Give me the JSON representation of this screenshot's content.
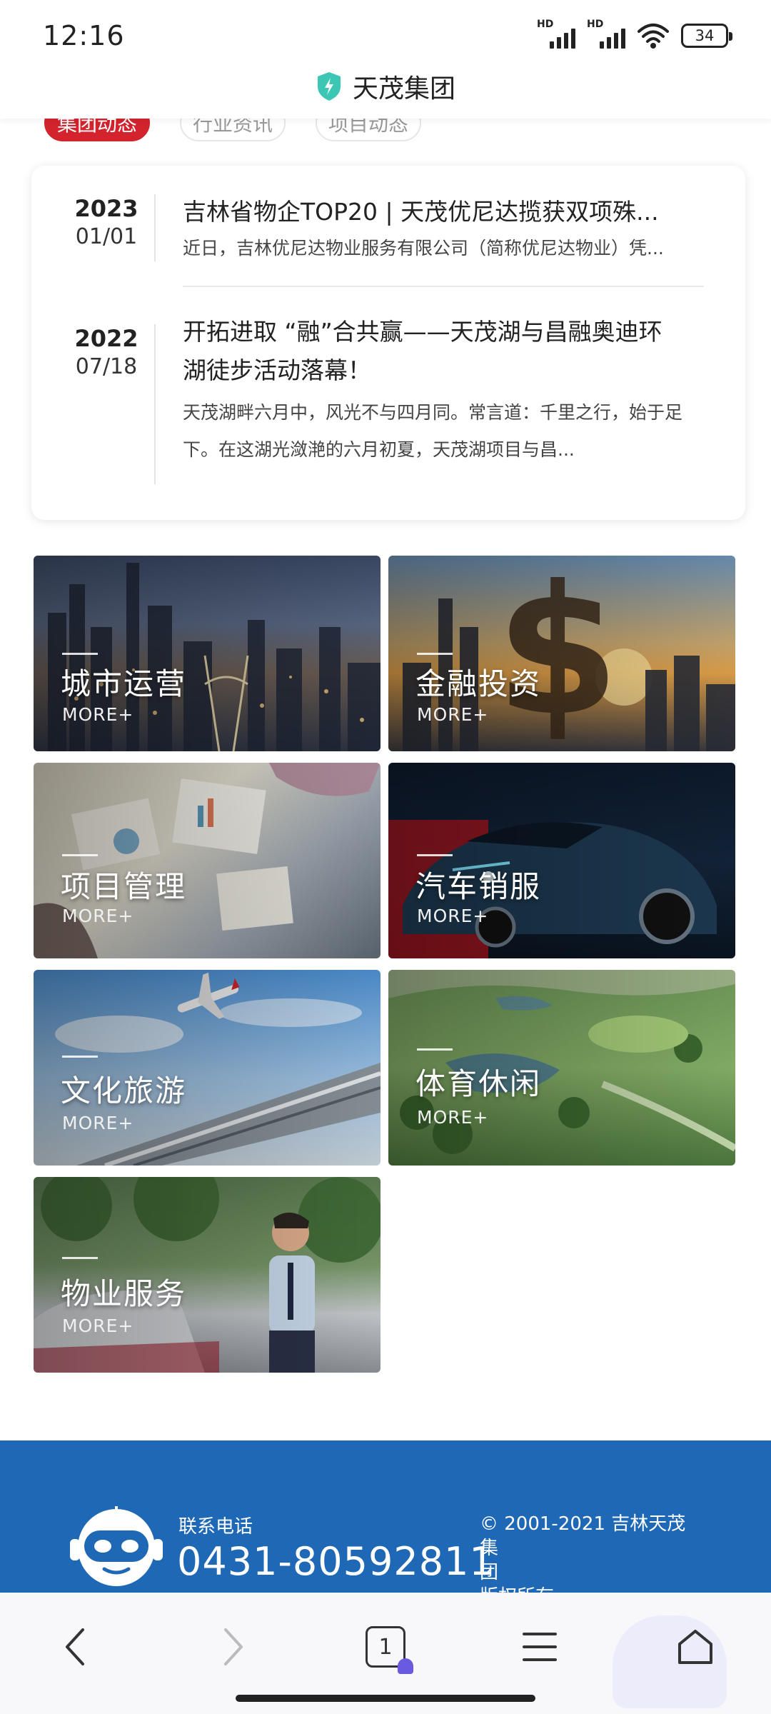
{
  "status_bar": {
    "time": "12:16",
    "signal1_label": "HD",
    "signal2_label": "HD",
    "battery": "34"
  },
  "header": {
    "title": "天茂集团",
    "logo_icon": "shield-bolt-icon",
    "accent": "#3cc6b4"
  },
  "tabs": [
    {
      "label": "集团动态",
      "active": true
    },
    {
      "label": "行业资讯",
      "active": false
    },
    {
      "label": "项目动态",
      "active": false
    }
  ],
  "news": [
    {
      "year": "2023",
      "date": "01/01",
      "title": "吉林省物企TOP20 | 天茂优尼达揽获双项殊...",
      "desc": "近日，吉林优尼达物业服务有限公司（简称优尼达物业）凭..."
    },
    {
      "year": "2022",
      "date": "07/18",
      "title_line1": "开拓进取 “融”合共赢——天茂湖与昌融奥迪环",
      "title_line2": "湖徒步活动落幕！",
      "desc_line1": "天茂湖畔六月中，风光不与四月同。常言道：千里之行，始于足",
      "desc_line2": "下。在这湖光潋滟的六月初夏，天茂湖项目与昌..."
    }
  ],
  "businesses": [
    {
      "name": "城市运营",
      "more": "MORE+"
    },
    {
      "name": "金融投资",
      "more": "MORE+"
    },
    {
      "name": "项目管理",
      "more": "MORE+"
    },
    {
      "name": "汽车销服",
      "more": "MORE+"
    },
    {
      "name": "文化旅游",
      "more": "MORE+"
    },
    {
      "name": "体育休闲",
      "more": "MORE+"
    },
    {
      "name": "物业服务",
      "more": "MORE+"
    }
  ],
  "footer": {
    "phone_label": "联系电话",
    "phone": "0431-80592811",
    "copyright_line1": "© 2001-2021 吉林天茂集",
    "copyright_line2": "团",
    "copyright_line3": "版权所有",
    "bg": "#1f68b5"
  },
  "bottom_nav": {
    "tab_count": "1"
  }
}
